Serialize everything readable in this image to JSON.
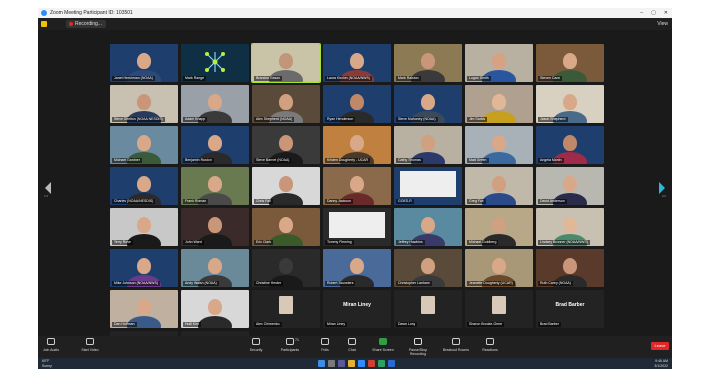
{
  "window": {
    "title": "Zoom Meeting Participant ID: 103501",
    "controls": [
      "–",
      "▢",
      "✕"
    ]
  },
  "topbar": {
    "recording": "Recording...",
    "view": "View"
  },
  "pages": {
    "left": "1/2",
    "right": "2/2"
  },
  "participants": [
    {
      "name": "Janet Hershman (NOAA)",
      "bg": "#1e3f6e",
      "skin": "#d9a888",
      "shirt": "#2b4a7a"
    },
    {
      "name": "Mark Range",
      "bg": "#0e2f44",
      "skin": "",
      "shirt": ""
    },
    {
      "name": "Brandon Eason",
      "bg": "#c9c3a8",
      "skin": "#c29578",
      "shirt": "#6b6b6b"
    },
    {
      "name": "Laura Kirchin (NOAA/NWS)",
      "bg": "#1e3f6e",
      "skin": "#d9a888",
      "shirt": "#8b3a3a"
    },
    {
      "name": "Mark Ralston",
      "bg": "#8c7a55",
      "skin": "#c9967a",
      "shirt": "#3a3a3a"
    },
    {
      "name": "Logan Smith",
      "bg": "#b8b0a0",
      "skin": "#d7a184",
      "shirt": "#2a56a0"
    },
    {
      "name": "Steven Cann",
      "bg": "#7a5a3a",
      "skin": "#d9a888",
      "shirt": "#3a5a3a"
    },
    {
      "name": "Steve Shelton (NOAA NESDIS)",
      "bg": "#c8c0b0",
      "skin": "#c9967a",
      "shirt": "#2a3a5a"
    },
    {
      "name": "Adam Knapp",
      "bg": "#9aa0a8",
      "skin": "#d9a888",
      "shirt": "#3a3a3a"
    },
    {
      "name": "Alex Shepherd (NOAA)",
      "bg": "#5a4a3a",
      "skin": "#d0a080",
      "shirt": "#7a7a7a"
    },
    {
      "name": "Ryan Henderson",
      "bg": "#1e3f6e",
      "skin": "#c08868",
      "shirt": "#2a2a2a"
    },
    {
      "name": "Steve Mahoney (NOAA)",
      "bg": "#1e3f6e",
      "skin": "#d9a888",
      "shirt": "#3a4a5a"
    },
    {
      "name": "Jim Sarkis",
      "bg": "#b0a090",
      "skin": "#e0b898",
      "shirt": "#c8a020"
    },
    {
      "name": "Jason Shepherd",
      "bg": "#d8d0c0",
      "skin": "#d9a888",
      "shirt": "#4a6a8a"
    },
    {
      "name": "Michael Gardner",
      "bg": "#6a8aa0",
      "skin": "#d9a888",
      "shirt": "#3a5a3a"
    },
    {
      "name": "Benjamin Ruston",
      "bg": "#1e3f6e",
      "skin": "#d9a888",
      "shirt": "#2a2a2a"
    },
    {
      "name": "Steve Barnet (NOAA)",
      "bg": "#3a3a3a",
      "skin": "#c9967a",
      "shirt": "#1a1a1a"
    },
    {
      "name": "Kristen Dougherty - UCAR",
      "bg": "#c08040",
      "skin": "#d9a888",
      "shirt": "#4a3a2a"
    },
    {
      "name": "Cathy Thomas",
      "bg": "#b8b0a0",
      "skin": "#d0a080",
      "shirt": "#2a3a6a"
    },
    {
      "name": "Matt Green",
      "bg": "#a8b0b8",
      "skin": "#d9a888",
      "shirt": "#3a6aa0"
    },
    {
      "name": "Angela Martin",
      "bg": "#1e3f6e",
      "skin": "#c08868",
      "shirt": "#a02a4a"
    },
    {
      "name": "Charles (NOAA/NESDIS)",
      "bg": "#1e3f6e",
      "skin": "#d9a888",
      "shirt": "#2a2a2a"
    },
    {
      "name": "Frank Roman",
      "bg": "#6a7a50",
      "skin": "#d9a888",
      "shirt": "#4a4a4a"
    },
    {
      "name": "Chris Fall",
      "bg": "#d8d8d8",
      "skin": "#c9967a",
      "shirt": "#2a2a2a"
    },
    {
      "name": "Danny Jackson",
      "bg": "#8a6a4a",
      "skin": "#d9a888",
      "shirt": "#6a2a2a"
    },
    {
      "name": "GOES-R",
      "bg": "#1e3f6e",
      "skin": "",
      "shirt": ""
    },
    {
      "name": "Greg Fox",
      "bg": "#c0b8a8",
      "skin": "#d0a080",
      "shirt": "#2a4a8a"
    },
    {
      "name": "David Anderson",
      "bg": "#b8b8b0",
      "skin": "#d9a888",
      "shirt": "#2a2a4a"
    },
    {
      "name": "Terry Rose",
      "bg": "#c8c8c8",
      "skin": "#d9a888",
      "shirt": "#1a1a1a"
    },
    {
      "name": "John Ward",
      "bg": "#3a2a2a",
      "skin": "#c9967a",
      "shirt": "#1a1a1a"
    },
    {
      "name": "Eric Clark",
      "bg": "#7a5a3a",
      "skin": "#d9a888",
      "shirt": "#3a5a2a"
    },
    {
      "name": "Tommy Fleming",
      "bg": "#2a2a2a",
      "skin": "",
      "shirt": ""
    },
    {
      "name": "Jeffrey Hawkins",
      "bg": "#5a8aa0",
      "skin": "#d9a888",
      "shirt": "#3a3a6a"
    },
    {
      "name": "Michael Goldberg",
      "bg": "#b8a888",
      "skin": "#d0a080",
      "shirt": "#2a2a2a"
    },
    {
      "name": "Lindsey Brunner (NOAA/NWS)",
      "bg": "#c8c0b0",
      "skin": "#e0b898",
      "shirt": "#4a8a6a"
    },
    {
      "name": "Mike Johnson (NOAA/NWS)",
      "bg": "#1e3f6e",
      "skin": "#d9a888",
      "shirt": "#6a3a8a"
    },
    {
      "name": "Andy Walsh (NOAA)",
      "bg": "#6a8a9a",
      "skin": "#d9a888",
      "shirt": "#3a3a3a"
    },
    {
      "name": "Christine Hester",
      "bg": "#2a2a2a",
      "skin": "#3a3a3a",
      "shirt": "#1a1a1a"
    },
    {
      "name": "Robert Saunders",
      "bg": "#4a6a9a",
      "skin": "#d9a888",
      "shirt": "#2a2a2a"
    },
    {
      "name": "Christopher Lanham",
      "bg": "#5a4a3a",
      "skin": "#d0a080",
      "shirt": "#3a3a3a"
    },
    {
      "name": "Jeanette Dougherty (UCAR)",
      "bg": "#a89878",
      "skin": "#d9a888",
      "shirt": "#6a4a2a"
    },
    {
      "name": "Ruth Carey (NOAA)",
      "bg": "#5a3a2a",
      "skin": "#c9967a",
      "shirt": "#2a2a2a"
    },
    {
      "name": "Dan Hoffman",
      "bg": "#c0b0a0",
      "skin": "#d9a888",
      "shirt": "#3a5a8a"
    },
    {
      "name": "Huili Kim",
      "bg": "#d8d8d8",
      "skin": "#d9a888",
      "shirt": "#2a2a2a"
    }
  ],
  "name_tiles": [
    {
      "display": "",
      "label": "Alex Chimenko",
      "photo": true
    },
    {
      "display": "Miran Liney",
      "label": "Miran Liney",
      "photo": false
    },
    {
      "display": "",
      "label": "Dawn Lorq",
      "photo": true
    },
    {
      "display": "",
      "label": "Sharon Brooke-Gene",
      "photo": true
    },
    {
      "display": "Brad Barber",
      "label": "Brad Barber",
      "photo": false
    },
    {
      "display": "",
      "label": "Josh Drake",
      "photo": true
    },
    {
      "display": "Christine Laney...",
      "label": "Christine Laney (NEON)",
      "photo": false
    }
  ],
  "toolbar": [
    {
      "label": "Join Audio",
      "icon": "headphones-icon"
    },
    {
      "label": "Start Video",
      "icon": "camera-off-icon"
    },
    {
      "label": "Security",
      "icon": "shield-icon"
    },
    {
      "label": "Participants",
      "icon": "participants-icon"
    },
    {
      "label": "Polls",
      "icon": "polls-icon"
    },
    {
      "label": "Chat",
      "icon": "chat-icon"
    },
    {
      "label": "Share Screen",
      "icon": "share-screen-icon"
    },
    {
      "label": "Pause/Stop Recording",
      "icon": "record-icon"
    },
    {
      "label": "Breakout Rooms",
      "icon": "breakout-icon"
    },
    {
      "label": "Reactions",
      "icon": "reactions-icon"
    }
  ],
  "participants_count": "71",
  "end_label": "Leave",
  "taskbar": {
    "weather_temp": "60°F",
    "weather_desc": "Sunny",
    "time": "9:46 AM",
    "date": "3/1/2022"
  },
  "colors": {
    "accent": "#2d8cff",
    "share": "#2ea043",
    "end": "#e02828",
    "active": "#a6e22e"
  }
}
